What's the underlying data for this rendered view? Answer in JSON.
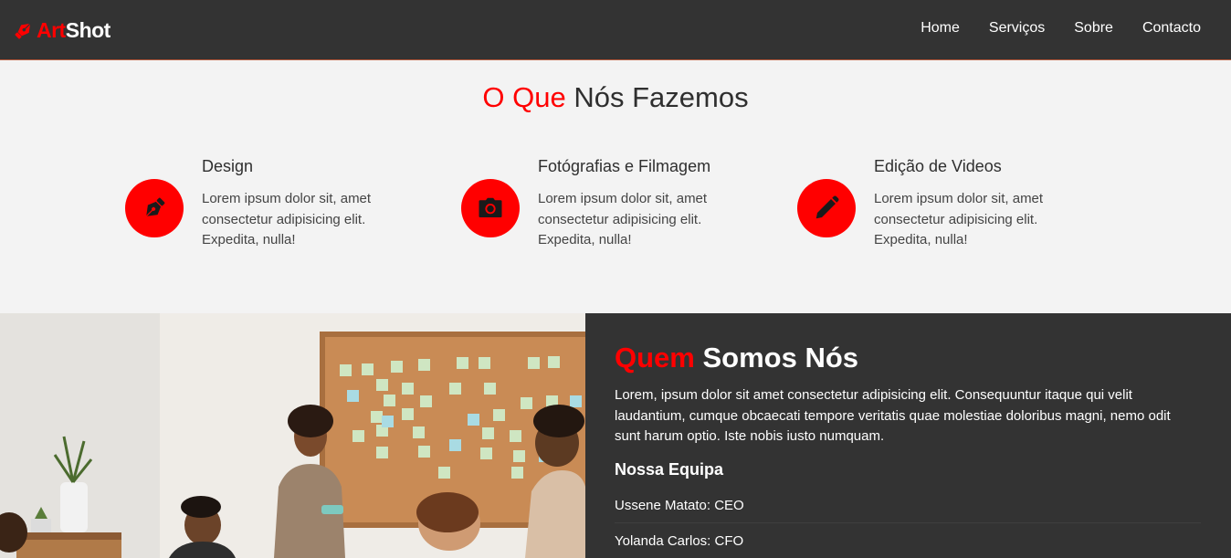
{
  "brand": {
    "part1": "Art",
    "part2": "Shot"
  },
  "nav": {
    "items": [
      "Home",
      "Serviços",
      "Sobre",
      "Contacto"
    ]
  },
  "services": {
    "title_accent": "O Que",
    "title_rest": "Nós Fazemos",
    "items": [
      {
        "title": "Design",
        "icon": "pen-nib-icon",
        "text": "Lorem ipsum dolor sit, amet consectetur adipisicing elit. Expedita, nulla!"
      },
      {
        "title": "Fotógrafias e Filmagem",
        "icon": "camera-icon",
        "text": "Lorem ipsum dolor sit, amet consectetur adipisicing elit. Expedita, nulla!"
      },
      {
        "title": "Edição de Videos",
        "icon": "pencil-icon",
        "text": "Lorem ipsum dolor sit, amet consectetur adipisicing elit. Expedita, nulla!"
      }
    ]
  },
  "about": {
    "title_accent": "Quem",
    "title_rest": "Somos Nós",
    "text": "Lorem, ipsum dolor sit amet consectetur adipisicing elit. Consequuntur itaque qui velit laudantium, cumque obcaecati tempore veritatis quae molestiae doloribus magni, nemo odit sunt harum optio. Iste nobis iusto numquam.",
    "team_title": "Nossa Equipa",
    "team": [
      "Ussene Matato: CEO",
      "Yolanda Carlos: CFO"
    ]
  },
  "colors": {
    "accent": "#ff0000",
    "dark": "#333333",
    "light": "#f3f3f3"
  }
}
